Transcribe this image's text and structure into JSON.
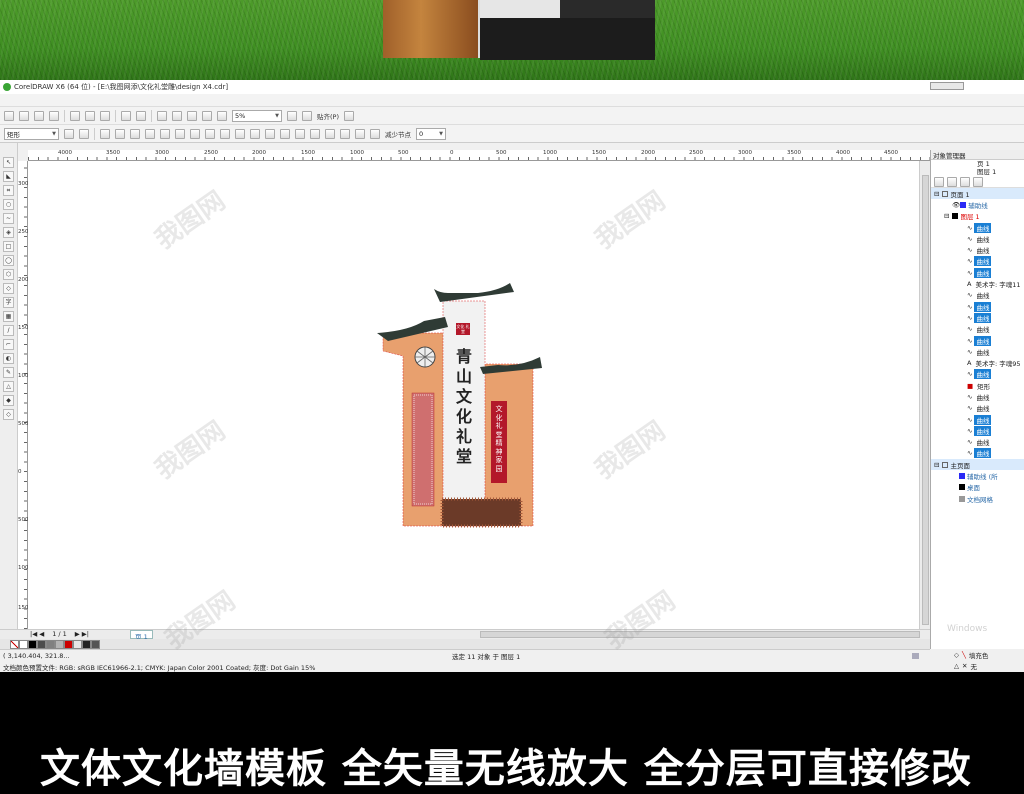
{
  "window": {
    "title": "CorelDRAW X6 (64 位) - [E:\\我图网添\\文化礼堂雕\\design X4.cdr]"
  },
  "propbar": {
    "object_type": "矩形",
    "zoom": "5%",
    "snap_label": "贴齐(P)",
    "reduce_nodes_label": "减少节点",
    "reduce_nodes_value": "0"
  },
  "rulers": {
    "h_labels": [
      "4000",
      "3500",
      "3000",
      "2500",
      "2000",
      "1500",
      "1000",
      "500",
      "0",
      "500",
      "1000",
      "1500",
      "2000",
      "2500",
      "3000",
      "3500",
      "4000",
      "4500"
    ],
    "v_labels": [
      "3000",
      "2500",
      "2000",
      "1500",
      "1000",
      "500",
      "0",
      "500",
      "1000",
      "1500"
    ]
  },
  "artwork": {
    "main_title": "青山文化礼堂",
    "red_panel_text": "文化礼堂 精神家园",
    "seal_text": "文化 礼堂"
  },
  "page_nav": {
    "counter": "1 / 1",
    "tab": "页 1"
  },
  "palette": [
    "#ffffff",
    "#000000",
    "#4d4d4d",
    "#808080",
    "#b3b3b3",
    "#cc0000",
    "#e6e6e6",
    "#222222",
    "#555555"
  ],
  "status": {
    "coords": "( 3,140.404, 321.8...",
    "selection": "选定 11 对象 于 图层 1",
    "color_profile": "文档颜色预置文件: RGB: sRGB IEC61966-2.1; CMYK: Japan Color 2001 Coated; 灰度: Dot Gain 15%",
    "fill_label": "填充色",
    "outline_label": "无"
  },
  "docker": {
    "title": "对象管理器",
    "page_header": "页 1",
    "layer_header": "图层 1",
    "page1_label": "页面 1",
    "guides_label": "辅助线",
    "layer1_label": "图层 1",
    "objects": [
      {
        "label": "曲线",
        "selected": true,
        "icon": "curve-icon"
      },
      {
        "label": "曲线",
        "selected": false,
        "icon": "curve-icon"
      },
      {
        "label": "曲线",
        "selected": false,
        "icon": "curve-outline-icon"
      },
      {
        "label": "曲线",
        "selected": true,
        "icon": "curve-outline-icon"
      },
      {
        "label": "曲线",
        "selected": true,
        "icon": "curve-icon"
      },
      {
        "label": "美术字: 字魂11",
        "selected": false,
        "icon": "text-icon"
      },
      {
        "label": "曲线",
        "selected": false,
        "icon": "curve-outline-icon"
      },
      {
        "label": "曲线",
        "selected": true,
        "icon": "curve-icon"
      },
      {
        "label": "曲线",
        "selected": true,
        "icon": "curve-icon"
      },
      {
        "label": "曲线",
        "selected": false,
        "icon": "curve-icon"
      },
      {
        "label": "曲线",
        "selected": true,
        "icon": "curve-outline-icon"
      },
      {
        "label": "曲线",
        "selected": false,
        "icon": "curve-outline-icon"
      },
      {
        "label": "美术字: 字魂95",
        "selected": false,
        "icon": "text-icon"
      },
      {
        "label": "曲线",
        "selected": true,
        "icon": "curve-outline-icon"
      },
      {
        "label": "矩形",
        "selected": false,
        "icon": "rectangle-icon"
      },
      {
        "label": "曲线",
        "selected": false,
        "icon": "curve-outline-icon"
      },
      {
        "label": "曲线",
        "selected": false,
        "icon": "curve-icon"
      },
      {
        "label": "曲线",
        "selected": true,
        "icon": "curve-icon"
      },
      {
        "label": "曲线",
        "selected": true,
        "icon": "curve-icon"
      },
      {
        "label": "曲线",
        "selected": false,
        "icon": "curve-icon"
      },
      {
        "label": "曲线",
        "selected": true,
        "icon": "curve-outline-icon"
      }
    ],
    "master_label": "主页面",
    "master_items": [
      "辅助线 (所",
      "桌面",
      "文档网格"
    ],
    "windows_text": "Windows"
  },
  "banner": {
    "text": "文体文化墙模板 全矢量无线放大 全分层可直接修改"
  },
  "watermark": "我图网",
  "colors": {
    "wall": "#e8a06e",
    "roof": "#2f3b35",
    "white_pillar": "#f2f2f2",
    "red": "#b3182a",
    "selection_blue": "#1a7fd4"
  }
}
